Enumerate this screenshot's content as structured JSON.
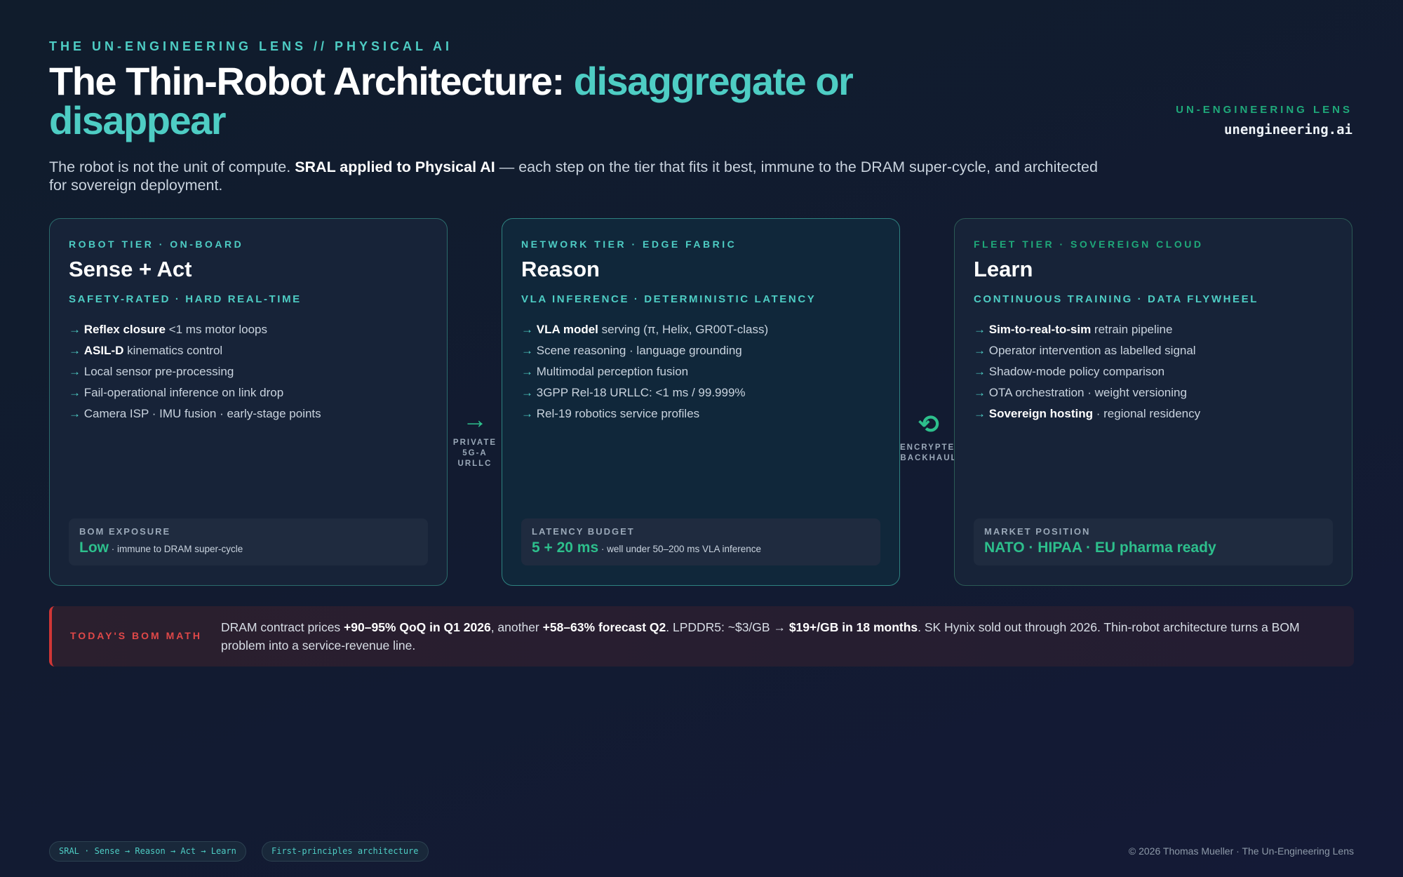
{
  "header": {
    "kicker": "THE UN-ENGINEERING LENS // PHYSICAL AI",
    "title_main": "The Thin-Robot Architecture:",
    "title_accent": "disaggregate or disappear",
    "lede_a": "The robot is not the unit of compute.",
    "lede_b": "SRAL applied to Physical AI",
    "lede_c": "— each step on the tier that fits it best, immune to the DRAM super-cycle, and architected for sovereign deployment."
  },
  "brand": {
    "kicker": "UN-ENGINEERING LENS",
    "url": "unengineering.ai"
  },
  "tiers": [
    {
      "tier_label": "ROBOT TIER · ON-BOARD",
      "title": "Sense + Act",
      "subtitle": "SAFETY-RATED · HARD REAL-TIME",
      "items": [
        {
          "bold": "Reflex closure",
          "text": " <1 ms motor loops"
        },
        {
          "bold": "ASIL-D",
          "text": " kinematics control"
        },
        {
          "bold": "",
          "text": "Local sensor pre-processing"
        },
        {
          "bold": "",
          "text": "Fail-operational inference on link drop"
        },
        {
          "bold": "",
          "text": "Camera ISP · IMU fusion · early-stage points"
        }
      ],
      "footer_label": "BOM EXPOSURE",
      "footer_value": "Low",
      "footer_note": " · immune to DRAM super-cycle"
    },
    {
      "tier_label": "NETWORK TIER · EDGE FABRIC",
      "title": "Reason",
      "subtitle": "VLA INFERENCE · DETERMINISTIC LATENCY",
      "items": [
        {
          "bold": "VLA model",
          "text": " serving (π, Helix, GR00T-class)"
        },
        {
          "bold": "",
          "text": "Scene reasoning · language grounding"
        },
        {
          "bold": "",
          "text": "Multimodal perception fusion"
        },
        {
          "bold": "",
          "text": "3GPP Rel-18 URLLC: <1 ms / 99.999%"
        },
        {
          "bold": "",
          "text": "Rel-19 robotics service profiles"
        }
      ],
      "footer_label": "LATENCY BUDGET",
      "footer_value": "5 + 20 ms",
      "footer_note": " · well under 50–200 ms VLA inference"
    },
    {
      "tier_label": "FLEET TIER · SOVEREIGN CLOUD",
      "title": "Learn",
      "subtitle": "CONTINUOUS TRAINING · DATA FLYWHEEL",
      "items": [
        {
          "bold": "Sim-to-real-to-sim",
          "text": " retrain pipeline"
        },
        {
          "bold": "",
          "text": "Operator intervention as labelled signal"
        },
        {
          "bold": "",
          "text": "Shadow-mode policy comparison"
        },
        {
          "bold": "",
          "text": "OTA orchestration · weight versioning"
        },
        {
          "bold": "Sovereign hosting",
          "text": " · regional residency"
        }
      ],
      "footer_label": "MARKET POSITION",
      "footer_value": "NATO · HIPAA · EU pharma ready",
      "footer_note": ""
    }
  ],
  "connectors": [
    {
      "symbol": "→",
      "icon": "arrow-right-icon",
      "label_lines": [
        "PRIVATE",
        "5G-A",
        "URLLC"
      ]
    },
    {
      "symbol": "⟲",
      "icon": "cycle-icon",
      "label_lines": [
        "ENCRYPTED",
        "BACKHAUL"
      ]
    }
  ],
  "bom_math": {
    "label": "TODAY'S BOM MATH",
    "t1": "DRAM contract prices ",
    "b1": "+90–95% QoQ in Q1 2026",
    "t2": ", another ",
    "b2": "+58–63% forecast Q2",
    "t3": ". LPDDR5: ~$3/GB → ",
    "b3": "$19+/GB in 18 months",
    "t4": ". SK Hynix sold out through 2026. Thin-robot architecture turns a BOM problem into a service-revenue line."
  },
  "footer": {
    "pills": [
      "SRAL · Sense → Reason → Act → Learn",
      "First-principles architecture"
    ],
    "copyright": "© 2026 Thomas Mueller · The Un-Engineering Lens"
  },
  "colors": {
    "accent_teal": "#4ecdc4",
    "accent_green": "#2dbf8c",
    "alert_red": "#e04848",
    "background": "#121b31"
  }
}
